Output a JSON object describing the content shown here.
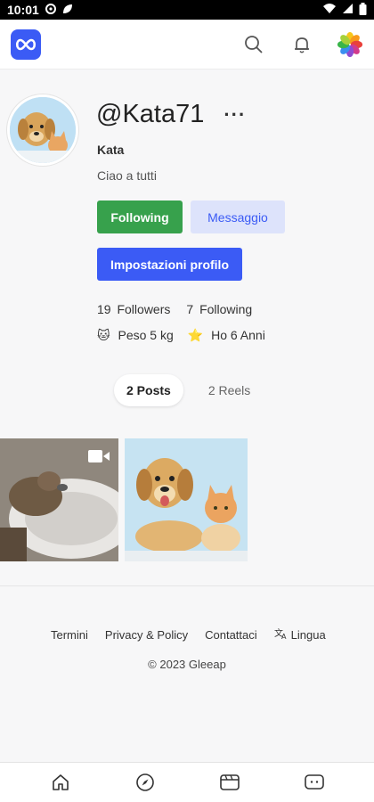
{
  "status_bar": {
    "time": "10:01",
    "left_icons": [
      "settings-gear-icon",
      "leaf-icon"
    ],
    "right_icons": [
      "wifi-icon",
      "signal-icon",
      "battery-icon"
    ]
  },
  "header": {
    "logo_icon": "infinity-logo-icon",
    "actions": [
      "search-icon",
      "bell-icon",
      "colorful-flower-avatar-icon"
    ]
  },
  "profile": {
    "username": "@Kata71",
    "more_label": "···",
    "display_name": "Kata",
    "bio": "Ciao a tutti",
    "buttons": {
      "following": "Following",
      "message": "Messaggio",
      "settings": "Impostazioni profilo"
    },
    "stats": {
      "followers_count": "19",
      "followers_label": "Followers",
      "following_count": "7",
      "following_label": "Following"
    },
    "details": [
      {
        "emoji": "🐱",
        "text": "Peso 5 kg"
      },
      {
        "emoji": "⭐",
        "text": "Ho 6 Anni"
      }
    ]
  },
  "tabs": [
    {
      "label": "2 Posts",
      "active": true
    },
    {
      "label": "2 Reels",
      "active": false
    }
  ],
  "posts": [
    {
      "type": "video",
      "icon": "video-camera-icon"
    },
    {
      "type": "image"
    }
  ],
  "footer": {
    "links": [
      "Termini",
      "Privacy & Policy",
      "Contattaci"
    ],
    "language_label": "Lingua",
    "copyright": "© 2023 Gleeap"
  },
  "bottom_nav": [
    "home-icon",
    "compass-icon",
    "reels-icon",
    "chat-icon"
  ],
  "colors": {
    "accent": "#3b5bf5",
    "following_green": "#37a14c",
    "message_bg": "#dde3fb"
  }
}
